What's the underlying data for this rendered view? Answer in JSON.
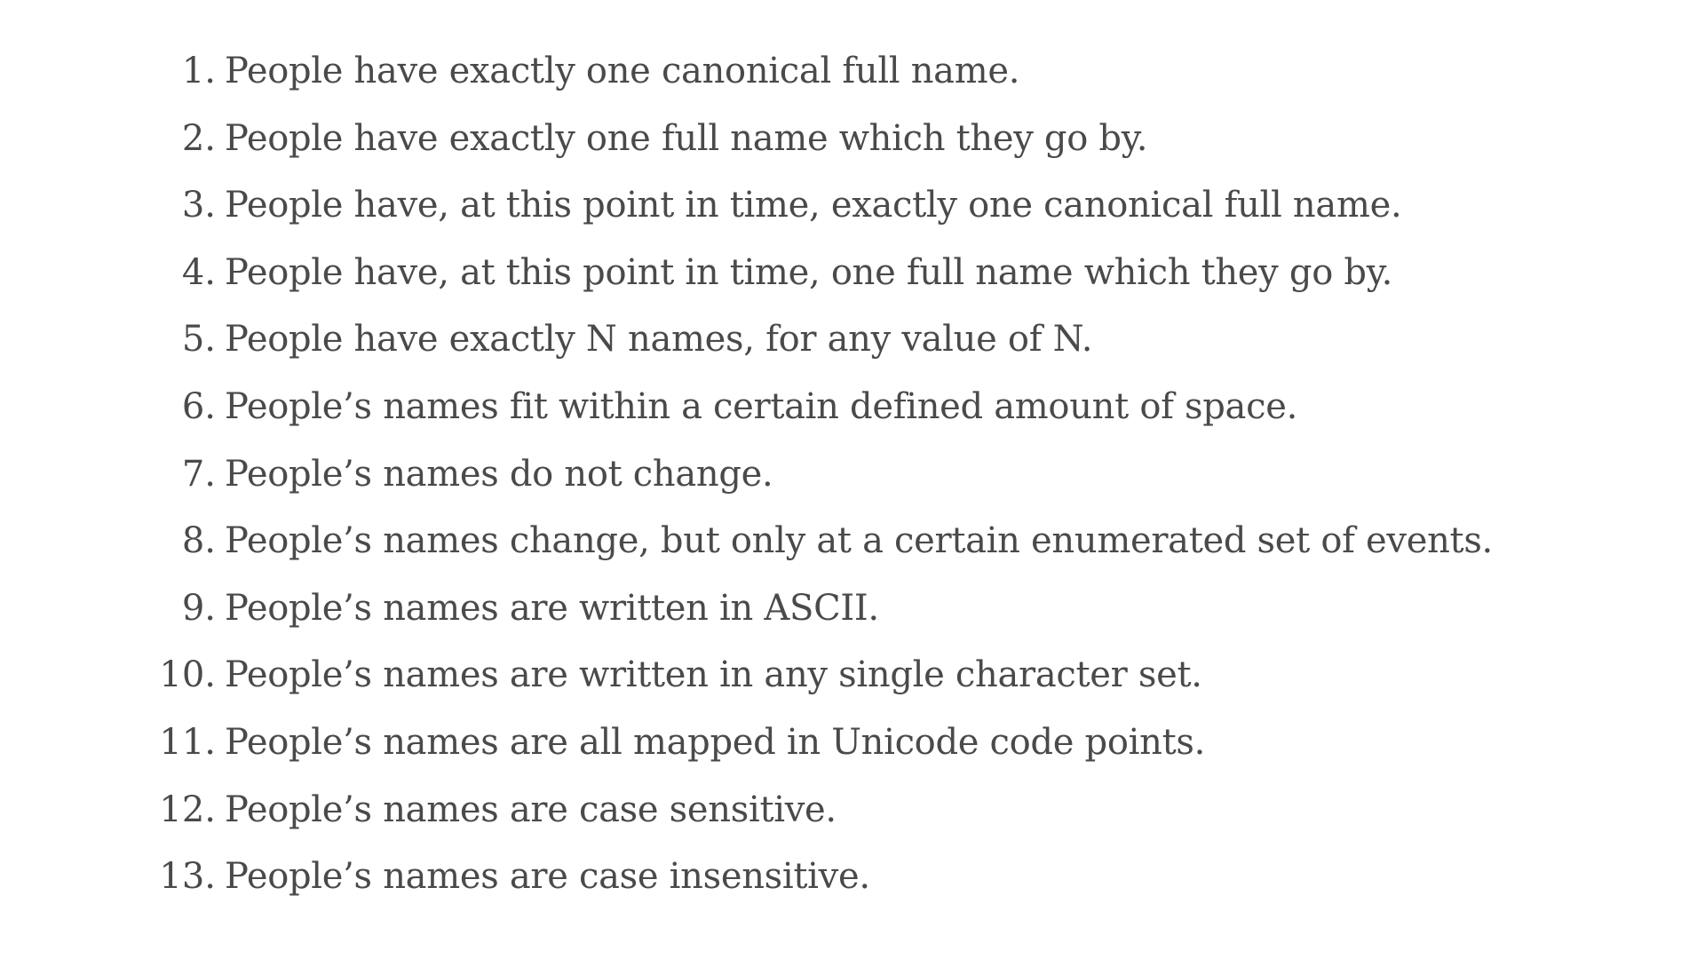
{
  "list": {
    "items": [
      {
        "number": "1.",
        "text": "People have exactly one canonical full name."
      },
      {
        "number": "2.",
        "text": "People have exactly one full name which they go by."
      },
      {
        "number": "3.",
        "text": "People have, at this point in time, exactly one canonical full name."
      },
      {
        "number": "4.",
        "text": "People have, at this point in time, one full name which they go by."
      },
      {
        "number": "5.",
        "text": "People have exactly N names, for any value of N."
      },
      {
        "number": "6.",
        "text": "People’s names fit within a certain defined amount of space."
      },
      {
        "number": "7.",
        "text": "People’s names do not change."
      },
      {
        "number": "8.",
        "text": "People’s names change, but only at a certain enumerated set of events."
      },
      {
        "number": "9.",
        "text": "People’s names are written in ASCII."
      },
      {
        "number": "10.",
        "text": "People’s names are written in any single character set."
      },
      {
        "number": "11.",
        "text": "People’s names are all mapped in Unicode code points."
      },
      {
        "number": "12.",
        "text": "People’s names are case sensitive."
      },
      {
        "number": "13.",
        "text": "People’s names are case insensitive."
      }
    ]
  }
}
